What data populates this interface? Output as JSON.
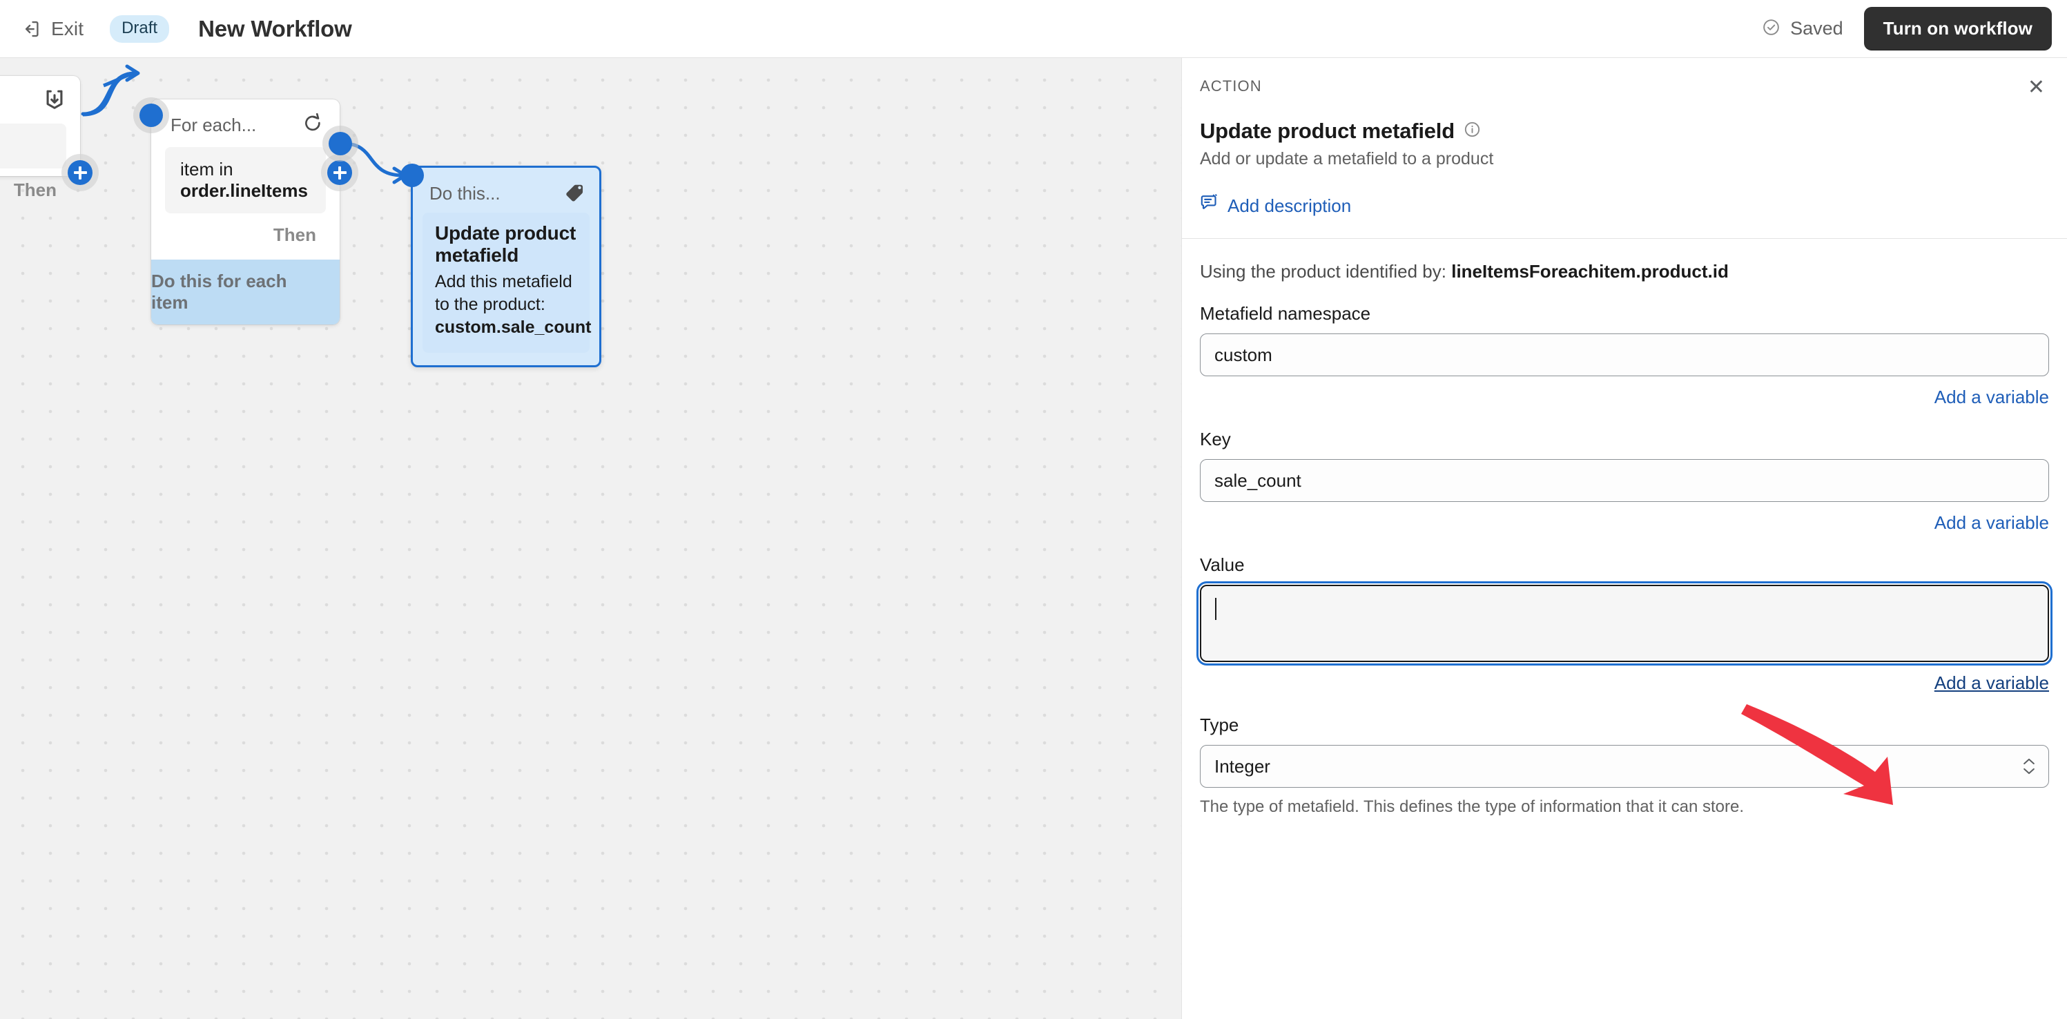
{
  "topbar": {
    "exit_label": "Exit",
    "exit_icon": "exit-door-icon",
    "status_badge": "Draft",
    "workflow_title": "New Workflow",
    "saved_label": "Saved",
    "saved_icon": "check-circle-icon",
    "primary_button": "Turn on workflow"
  },
  "canvas": {
    "trigger_node": {
      "icon": "order-received-icon",
      "then_label": "Then"
    },
    "foreach_node": {
      "title": "For each...",
      "icon": "loop-repeat-icon",
      "field_prefix": "item in ",
      "field_value": "order.lineItems",
      "then_label": "Then",
      "footer_label": "Do this for each item"
    },
    "action_node": {
      "title": "Do this...",
      "icon": "tag-icon",
      "name": "Update product metafield",
      "description": "Add this metafield to the product:",
      "metafield": "custom.sale_count"
    }
  },
  "panel": {
    "kicker": "ACTION",
    "close_icon": "close-icon",
    "title": "Update product metafield",
    "info_icon": "info-circle-icon",
    "subtitle": "Add or update a metafield to a product",
    "add_description_label": "Add description",
    "add_description_icon": "comment-edit-icon",
    "using_prefix": "Using the product identified by: ",
    "using_value": "lineItemsForeachitem.product.id",
    "fields": {
      "namespace": {
        "label": "Metafield namespace",
        "value": "custom",
        "add_variable": "Add a variable"
      },
      "key": {
        "label": "Key",
        "value": "sale_count",
        "add_variable": "Add a variable"
      },
      "value": {
        "label": "Value",
        "value": "",
        "add_variable": "Add a variable"
      },
      "type": {
        "label": "Type",
        "value": "Integer",
        "help": "The type of metafield. This defines the type of information that it can store.",
        "chevron_icon": "chevron-updown-icon"
      }
    }
  },
  "annotation": {
    "arrow_icon": "red-pointer-arrow",
    "arrow_color": "#ef3340"
  }
}
